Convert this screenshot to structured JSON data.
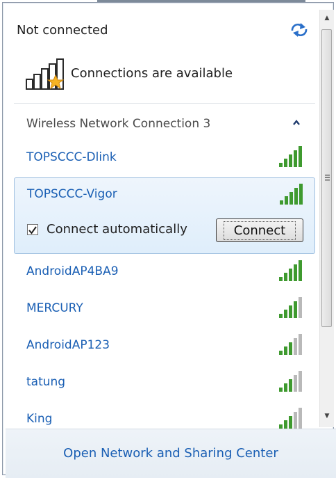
{
  "status": {
    "title": "Not connected",
    "available_text": "Connections are available",
    "available_icon": "signal-bars-star-icon",
    "refresh_icon": "refresh-arrows-icon"
  },
  "section": {
    "title": "Wireless Network Connection 3",
    "collapse_icon": "chevron-up-icon"
  },
  "networks": [
    {
      "name": "TOPSCCC-Dlink",
      "signal": 5
    },
    {
      "name": "TOPSCCC-Vigor",
      "signal": 5
    },
    {
      "name": "AndroidAP4BA9",
      "signal": 5
    },
    {
      "name": "MERCURY",
      "signal": 4
    },
    {
      "name": "AndroidAP123",
      "signal": 3
    },
    {
      "name": "tatung",
      "signal": 3
    },
    {
      "name": "King",
      "signal": 3
    }
  ],
  "selected": {
    "checkbox_label": "Connect automatically",
    "checkbox_checked": true,
    "connect_label": "Connect"
  },
  "footer": {
    "link_text": "Open Network and Sharing Center"
  },
  "colors": {
    "link": "#1a5fb4",
    "signal_green": "#3f9a2f",
    "signal_gray": "#b9b9b9"
  }
}
